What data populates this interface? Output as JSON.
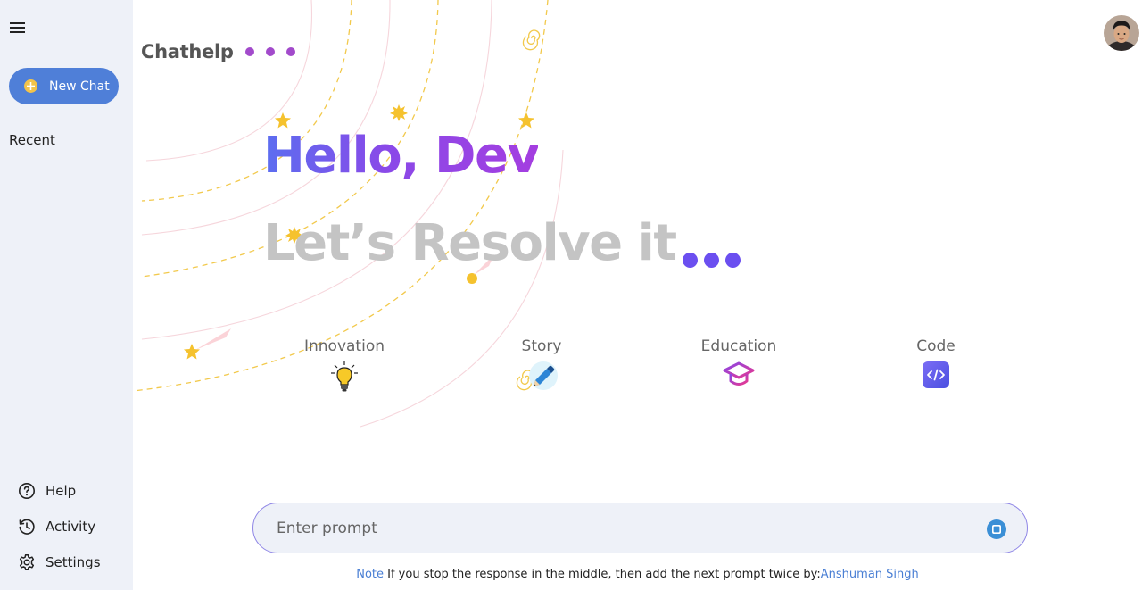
{
  "sidebar": {
    "new_chat_label": "New Chat",
    "recent_label": "Recent",
    "bottom_items": [
      {
        "label": "Help",
        "icon": "help-circle-icon"
      },
      {
        "label": "Activity",
        "icon": "history-icon"
      },
      {
        "label": "Settings",
        "icon": "gear-icon"
      }
    ]
  },
  "header": {
    "brand": "Chathelp",
    "avatar_icon": "user-avatar"
  },
  "greeting": {
    "hello": "Hello, Dev",
    "subtitle": "Let’s Resolve it"
  },
  "cards": [
    {
      "title": "Innovation",
      "icon": "lightbulb-icon"
    },
    {
      "title": "Story",
      "icon": "pencil-icon"
    },
    {
      "title": "Education",
      "icon": "graduation-cap-icon"
    },
    {
      "title": "Code",
      "icon": "code-icon"
    }
  ],
  "prompt": {
    "placeholder": "Enter prompt",
    "stop_icon": "stop-icon"
  },
  "footer": {
    "note_label": "Note",
    "note_text": " If you stop the response in the middle, then add the next prompt twice by:",
    "author": "Anshuman Singh"
  },
  "colors": {
    "sidebar_bg": "#eef1f8",
    "new_chat_bg": "#4f7fd8",
    "accent_purple": "#a24acb",
    "dot_blue": "#6b4ff0",
    "link_blue": "#4a7fd4"
  }
}
